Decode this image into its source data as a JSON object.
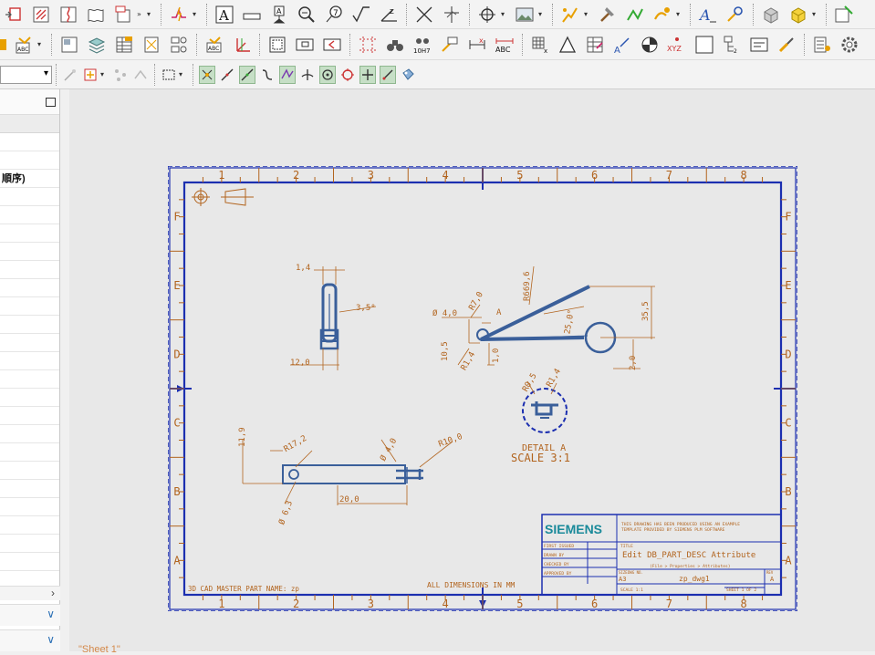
{
  "toolbar3": {
    "layer_dropdown_value": ""
  },
  "left_panel": {
    "rows": [
      "",
      "",
      "順序)",
      "",
      "",
      "",
      "",
      "",
      "",
      "",
      "",
      "",
      "",
      "",
      "",
      "",
      "",
      "",
      "",
      "",
      "",
      "",
      "",
      "",
      ""
    ]
  },
  "sheet_tab": "\"Sheet 1\"",
  "drawing": {
    "column_labels": [
      "1",
      "2",
      "3",
      "4",
      "5",
      "6",
      "7",
      "8"
    ],
    "row_labels": [
      "F",
      "E",
      "D",
      "C",
      "B",
      "A"
    ],
    "master_part": "3D CAD MASTER PART NAME:  zp",
    "all_dims": "ALL DIMENSIONS IN MM",
    "detail_label": "DETAIL A",
    "detail_scale": "SCALE 3:1",
    "dims": {
      "d14": "1,4",
      "d35deg": "3,5°",
      "d120": "12,0",
      "d70": "R7,0",
      "d_a": "A",
      "d6696": "R669,6",
      "d250": "25,0°",
      "d355": "35,5",
      "d_phi40": "Ø 4,0",
      "d105": "10,5",
      "d_r14": "R1,4",
      "d10": "1,0",
      "d20": "2,0",
      "d_r05": "R0,5",
      "d_r14b": "R1,4",
      "d119": "11,9",
      "d172": "R17,2",
      "d_phi40b": "Ø 4,0",
      "d100": "R10,0",
      "d63": "Ø 6,3",
      "d200": "20,0"
    },
    "title_block": {
      "logo": "SIEMENS",
      "notice": "THIS DRAWING HAS BEEN PRODUCED USING AN EXAMPLE TEMPLATE PROVIDED BY SIEMENS PLM SOFTWARE",
      "first_issued": "FIRST ISSUED",
      "drawn_by": "DRAWN BY",
      "checked_by": "CHECKED BY",
      "approved_by": "APPROVED BY",
      "title_label": "TITLE",
      "title": "Edit DB_PART_DESC Attribute",
      "subtitle": "(File > Properties > Attributes)",
      "size_label": "SIZE",
      "dwg_no_label": "DWG NO.",
      "size": "A3",
      "dwg_no": "zp_dwg1",
      "rev_label": "REV",
      "rev": "A",
      "scale": "SCALE 1:1",
      "sheet": "SHEET 1 OF 2"
    }
  }
}
